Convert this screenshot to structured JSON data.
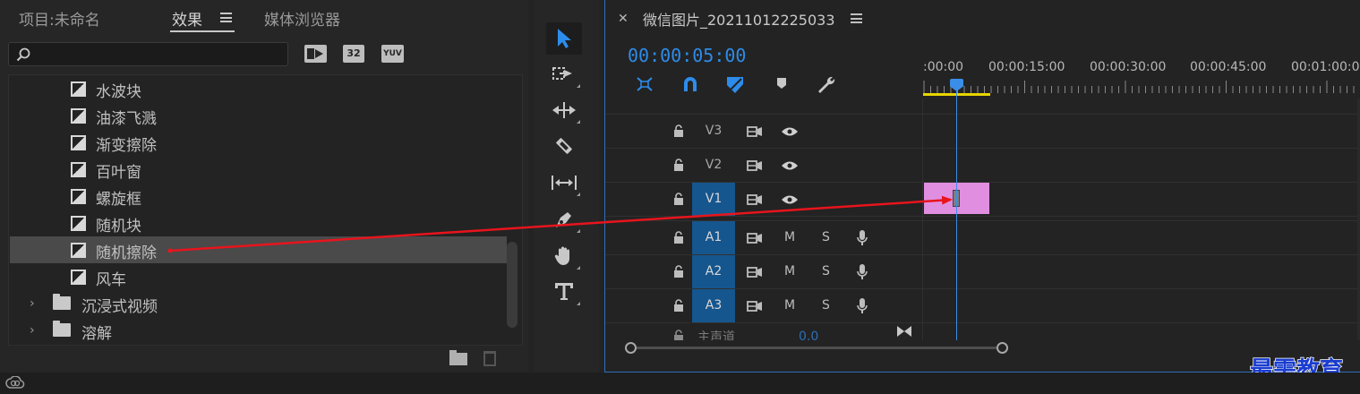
{
  "effects_panel": {
    "tabs": [
      {
        "label": "项目:未命名",
        "active": false
      },
      {
        "label": "效果",
        "active": true
      },
      {
        "label": "媒体浏览器",
        "active": false
      }
    ],
    "search": {
      "placeholder": "",
      "value": ""
    },
    "filter_badges": [
      "32",
      "YUV"
    ],
    "items": [
      {
        "label": "水波块",
        "type": "preset",
        "selected": false
      },
      {
        "label": "油漆飞溅",
        "type": "preset",
        "selected": false
      },
      {
        "label": "渐变擦除",
        "type": "preset",
        "selected": false
      },
      {
        "label": "百叶窗",
        "type": "preset",
        "selected": false
      },
      {
        "label": "螺旋框",
        "type": "preset",
        "selected": false
      },
      {
        "label": "随机块",
        "type": "preset",
        "selected": false
      },
      {
        "label": "随机擦除",
        "type": "preset",
        "selected": true
      },
      {
        "label": "风车",
        "type": "preset",
        "selected": false
      },
      {
        "label": "沉浸式视频",
        "type": "folder",
        "selected": false
      },
      {
        "label": "溶解",
        "type": "folder",
        "selected": false
      }
    ]
  },
  "tools": [
    "selection-tool",
    "track-select-tool",
    "ripple-edit-tool",
    "razor-tool",
    "slip-tool",
    "pen-tool",
    "hand-tool",
    "type-tool"
  ],
  "timeline": {
    "sequence_title": "微信图片_20211012225033",
    "timecode": "00:00:05:00",
    "ruler_labels": [
      ":00:00",
      "00:00:15:00",
      "00:00:30:00",
      "00:00:45:00",
      "00:01:00:00"
    ],
    "video_tracks": [
      {
        "label": "V3",
        "targeted": false
      },
      {
        "label": "V2",
        "targeted": false
      },
      {
        "label": "V1",
        "targeted": true
      }
    ],
    "audio_tracks": [
      {
        "label": "A1",
        "targeted": true,
        "mute": "M",
        "solo": "S"
      },
      {
        "label": "A2",
        "targeted": true,
        "mute": "M",
        "solo": "S"
      },
      {
        "label": "A3",
        "targeted": true,
        "mute": "M",
        "solo": "S"
      }
    ],
    "master": {
      "label": "主声道",
      "value": "0.0"
    },
    "clip_color": "#e08ee0",
    "accent_color": "#2d8ceb"
  },
  "watermark": "最需教育"
}
